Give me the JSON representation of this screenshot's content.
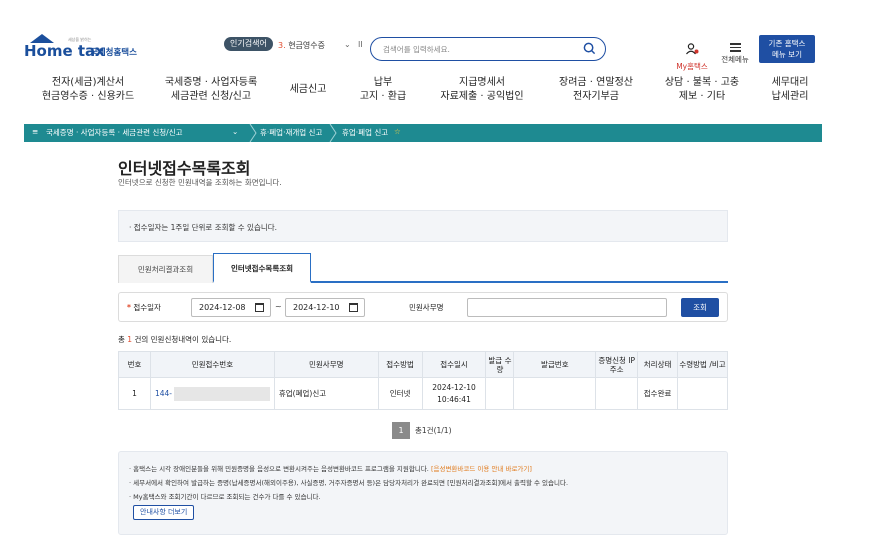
{
  "header": {
    "logo_text": "Home tax",
    "logo_sub": "세상을 밝히는",
    "logo_name": "국세청홈택스",
    "popular_label": "인기검색어",
    "rank_num": "3.",
    "rank_text": "현금영수증",
    "rank_chev": "⌄",
    "rank_pause": "II",
    "search_placeholder": "검색어를 입력하세요.",
    "my_label": "My홈택스",
    "allmenu_label": "전체메뉴",
    "basic_btn_line1": "기존 홈택스",
    "basic_btn_line2": "메뉴 보기"
  },
  "gnb": [
    {
      "l1": "전자(세금)계산서",
      "l2": "현금영수증 · 신용카드"
    },
    {
      "l1": "국세증명 · 사업자등록",
      "l2": "세금관련 신청/신고"
    },
    {
      "l1": "세금신고",
      "l2": ""
    },
    {
      "l1": "납부",
      "l2": "고지 · 환급"
    },
    {
      "l1": "지급명세서",
      "l2": "자료제출 · 공익법인"
    },
    {
      "l1": "장려금 · 연말정산",
      "l2": "전자기부금"
    },
    {
      "l1": "상담 · 불복 · 고충",
      "l2": "제보 · 기타"
    },
    {
      "l1": "세무대리",
      "l2": "납세관리"
    }
  ],
  "breadcrumb": {
    "menu_icon": "≡",
    "level1": "국세증명 · 사업자등록 · 세금관련 신청/신고",
    "level1_chev": "⌄",
    "level2": "휴·폐업·재개업 신고",
    "level3": "휴업·폐업 신고",
    "star": "☆"
  },
  "page": {
    "title": "인터넷접수목록조회",
    "desc": "인터넷으로 신청한 민원내역을 조회하는 화면입니다.",
    "notice": "· 접수일자는 1주일 단위로 조회할 수 있습니다."
  },
  "tabs": [
    "민원처리결과조회",
    "인터넷접수목록조회"
  ],
  "filter": {
    "required_mark": "*",
    "date_label": "접수일자",
    "date_from": "2024-12-08",
    "tilde": "~",
    "date_to": "2024-12-10",
    "name_label": "민원사무명",
    "name_value": "",
    "search_btn": "조회"
  },
  "result": {
    "prefix": "총",
    "count": "1",
    "suffix": "건의 민원신청내역이 있습니다."
  },
  "table": {
    "headers": [
      "번호",
      "민원접수번호",
      "민원사무명",
      "접수방법",
      "접수일시",
      "발급 수량",
      "발급번호",
      "증명신청 IP주소",
      "처리상태",
      "수령방법 /비고"
    ],
    "rows": [
      {
        "no": "1",
        "receipt_no": "144-",
        "service": "휴업(폐업)신고",
        "method": "인터넷",
        "date": "2024-12-10",
        "time": "10:46:41",
        "qty": "",
        "issue_no": "",
        "ip": "",
        "status": "접수완료",
        "remark": ""
      }
    ]
  },
  "pager": {
    "page": "1",
    "text": "총1건(1/1)"
  },
  "info": {
    "line1_a": "· 홈택스는 시각 장애인분들을 위해 민원증명을 음성으로 변환시켜주는 음성변환바코드 프로그램을 지원합니다.",
    "line1_link": "[음성변환바코드 이용 안내 바로가기]",
    "line2": "· 세무서에서 확인하여 발급하는 증명(납세증명서(해외이주용), 사실증명, 거주자증명서 등)은 담당자처리가 완료되면 [민원처리결과조회]에서 출력할 수 있습니다.",
    "line3": "· My홈택스와 조회기간이 다르므로 조회되는 건수가 다를 수 있습니다.",
    "more_btn": "안내사항 더보기"
  },
  "colors": {
    "primary": "#1f4fa3",
    "teal_bar": "#1e8a91",
    "accent_red": "#e04b2d",
    "link_orange": "#e07a1c"
  }
}
